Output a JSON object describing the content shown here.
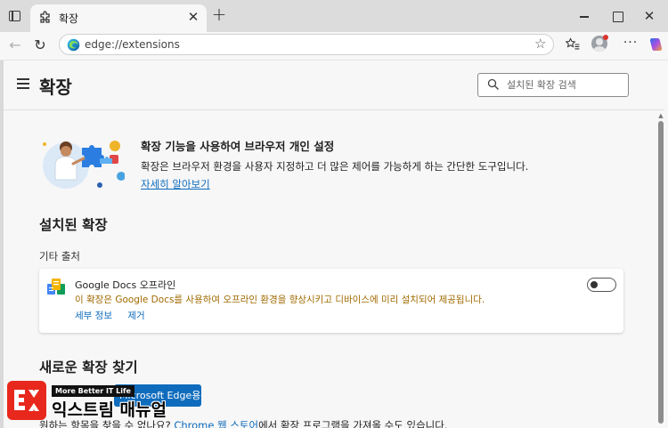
{
  "tab": {
    "title": "확장",
    "close_glyph": "✕"
  },
  "toolbar": {
    "address": "edge://extensions",
    "back_glyph": "←",
    "reload_glyph": "↻",
    "star_glyph": "☆",
    "favorites_glyph": "☆",
    "more_glyph": "···",
    "new_tab_glyph": "+",
    "window_close_glyph": "✕"
  },
  "header": {
    "title": "확장",
    "search_placeholder": "설치된 확장 검색"
  },
  "promo": {
    "title": "확장 기능을 사용하여 브라우저 개인 설정",
    "description": "확장은 브라우저 환경을 사용자 지정하고 더 많은 제어를 가능하게 하는 간단한 도구입니다.",
    "link": "자세히 알아보기"
  },
  "installed": {
    "heading": "설치된 확장",
    "group_label": "기타 출처",
    "extensions": [
      {
        "name": "Google Docs 오프라인",
        "description": "이 확장은 Google Docs를 사용하여 오프라인 환경을 향상시키고 디바이스에 미리 설치되어 제공됩니다.",
        "details_link": "세부 정보",
        "remove_link": "제거",
        "enabled": false
      }
    ]
  },
  "find": {
    "heading": "새로운 확장 찾기",
    "button": "Microsoft Edge용 확장 가져오기",
    "text_before": "원하는 항목을 찾을 수 없나요? ",
    "store_link": "Chrome 웹 스토어",
    "text_after": "에서 확장 프로그램을 가져올 수도 있습니다."
  },
  "watermark": {
    "badge": "More Better IT Life",
    "brand": "익스트림 매뉴얼"
  },
  "colors": {
    "accent": "#0f6cbd",
    "warning_text": "#a06a00",
    "watermark_red": "#e8281c"
  }
}
